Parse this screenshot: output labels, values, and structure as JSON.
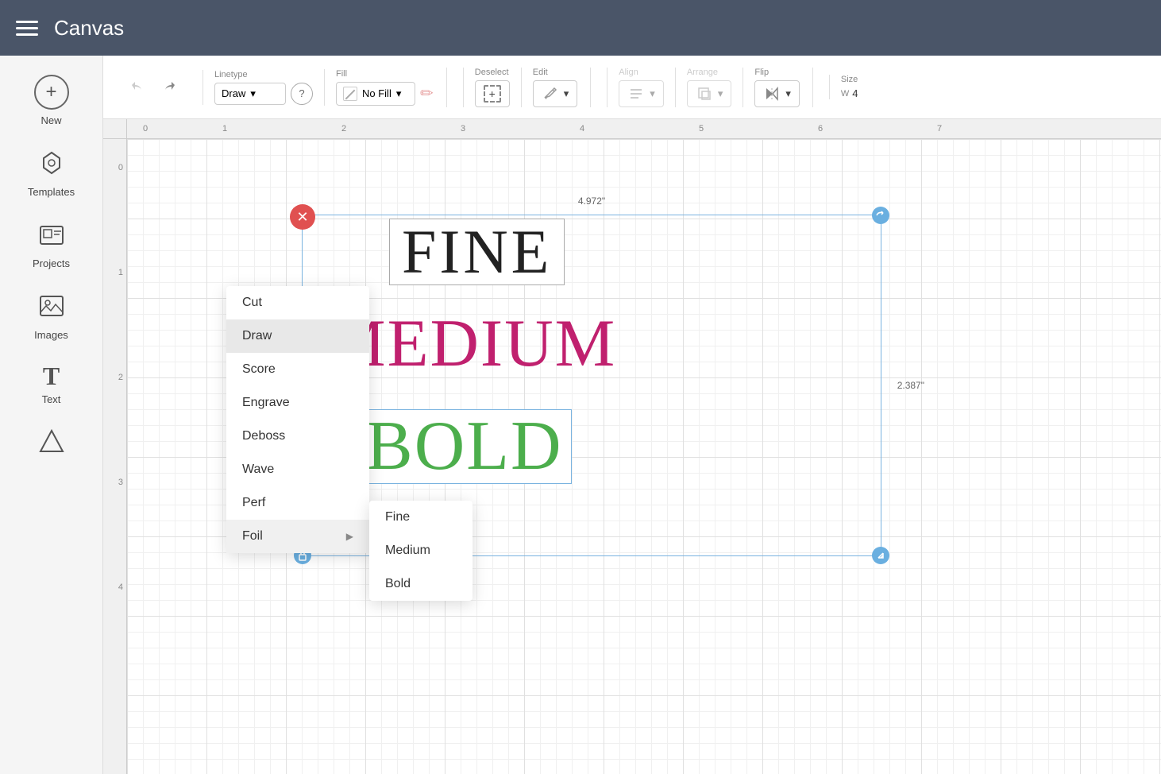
{
  "header": {
    "title": "Canvas",
    "menu_icon": "☰"
  },
  "sidebar": {
    "items": [
      {
        "id": "new",
        "label": "New",
        "icon": "⊕"
      },
      {
        "id": "templates",
        "label": "Templates",
        "icon": "👕"
      },
      {
        "id": "projects",
        "label": "Projects",
        "icon": "🖼"
      },
      {
        "id": "images",
        "label": "Images",
        "icon": "🏔"
      },
      {
        "id": "text",
        "label": "Text",
        "icon": "T"
      },
      {
        "id": "shapes",
        "label": "Shapes",
        "icon": "★"
      }
    ]
  },
  "toolbar": {
    "undo_label": "↩",
    "redo_label": "↪",
    "linetype_label": "Linetype",
    "linetype_value": "Draw",
    "help_label": "?",
    "fill_label": "Fill",
    "fill_value": "No Fill",
    "deselect_label": "Deselect",
    "edit_label": "Edit",
    "align_label": "Align",
    "arrange_label": "Arrange",
    "flip_label": "Flip",
    "size_label": "Size",
    "size_w_label": "W",
    "size_w_value": "4"
  },
  "canvas": {
    "ruler_numbers_h": [
      "0",
      "1",
      "2",
      "3",
      "4",
      "5",
      "6",
      "7"
    ],
    "ruler_numbers_v": [
      "0",
      "1",
      "2",
      "3",
      "4"
    ],
    "dimension_top": "4.972\"",
    "dimension_right": "2.387\"",
    "text_fine": "FINE",
    "text_medium": "MEDIUM",
    "text_bold": "BOLD"
  },
  "linetype_menu": {
    "items": [
      {
        "id": "cut",
        "label": "Cut",
        "has_submenu": false
      },
      {
        "id": "draw",
        "label": "Draw",
        "has_submenu": false,
        "active": true
      },
      {
        "id": "score",
        "label": "Score",
        "has_submenu": false
      },
      {
        "id": "engrave",
        "label": "Engrave",
        "has_submenu": false
      },
      {
        "id": "deboss",
        "label": "Deboss",
        "has_submenu": false
      },
      {
        "id": "wave",
        "label": "Wave",
        "has_submenu": false
      },
      {
        "id": "perf",
        "label": "Perf",
        "has_submenu": false
      },
      {
        "id": "foil",
        "label": "Foil",
        "has_submenu": true
      }
    ],
    "foil_submenu": [
      {
        "id": "fine",
        "label": "Fine"
      },
      {
        "id": "medium",
        "label": "Medium"
      },
      {
        "id": "bold",
        "label": "Bold"
      }
    ]
  }
}
